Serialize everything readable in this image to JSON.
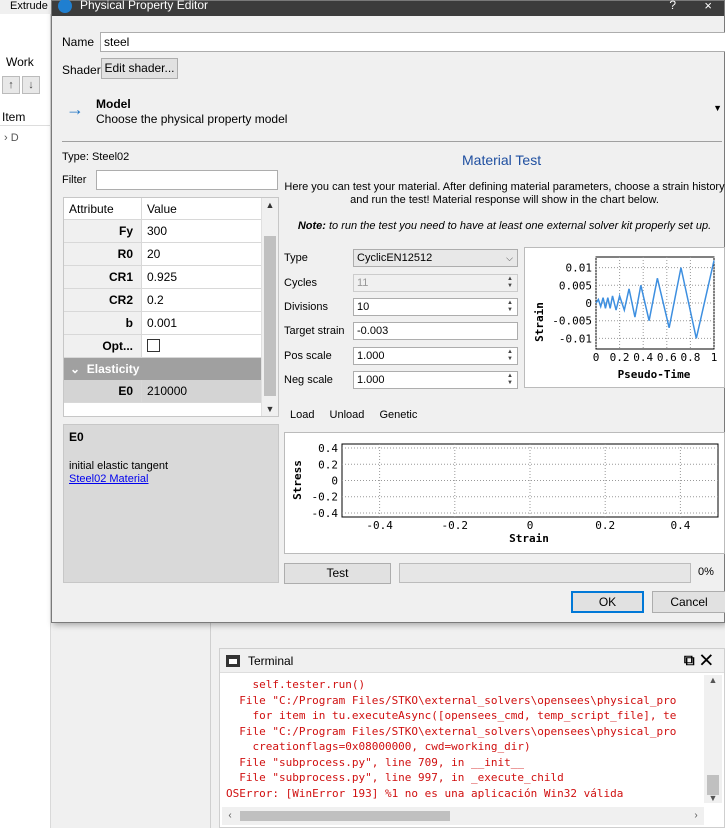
{
  "background": {
    "tab_label": "Extrude",
    "panel_label": "Work",
    "tree_header": "Item",
    "tree_items": [
      "D",
      "",
      "",
      "",
      "",
      "",
      "",
      "",
      ""
    ]
  },
  "dialog": {
    "title": "Physical Property Editor",
    "help_label": "?",
    "close_label": "×",
    "name_label": "Name",
    "name_value": "steel",
    "shader_label": "Shader",
    "shader_button": "Edit shader...",
    "model_title": "Model",
    "model_desc": "Choose the physical property model",
    "type_label": "Type:",
    "type_value": "Steel02",
    "filter_label": "Filter",
    "filter_value": "",
    "table": {
      "headers": [
        "Attribute",
        "Value"
      ],
      "rows": [
        {
          "key": "Fy",
          "value": "300"
        },
        {
          "key": "R0",
          "value": "20"
        },
        {
          "key": "CR1",
          "value": "0.925"
        },
        {
          "key": "CR2",
          "value": "0.2"
        },
        {
          "key": "b",
          "value": "0.001"
        },
        {
          "key": "Opt...",
          "value": ""
        }
      ],
      "group": "Elasticity",
      "group_rows": [
        {
          "key": "E0",
          "value": "210000"
        }
      ]
    },
    "desc": {
      "title": "E0",
      "text": "initial elastic tangent",
      "link": "Steel02 Material"
    },
    "material_test": {
      "title": "Material Test",
      "intro": "Here you can test your material. After defining material parameters, choose a strain history and run the test! Material response will show in the chart below.",
      "note_bold": "Note:",
      "note_text": " to run the test you need to have at least one external solver kit properly set up.",
      "params": {
        "type_label": "Type",
        "type_value": "CyclicEN12512",
        "cycles_label": "Cycles",
        "cycles_value": "11",
        "divisions_label": "Divisions",
        "divisions_value": "10",
        "target_label": "Target strain",
        "target_value": "-0.003",
        "pos_label": "Pos scale",
        "pos_value": "1.000",
        "neg_label": "Neg scale",
        "neg_value": "1.000"
      },
      "tabs": [
        "Load",
        "Unload",
        "Genetic"
      ],
      "test_button": "Test",
      "progress_percent": 0,
      "progress_text": "0%"
    },
    "ok_button": "OK",
    "cancel_button": "Cancel"
  },
  "terminal": {
    "title": "Terminal",
    "lines": [
      "    self.tester.run()",
      "  File \"C:/Program Files/STKO\\external_solvers\\opensees\\physical_pro",
      "    for item in tu.executeAsync([opensees_cmd, temp_script_file], te",
      "  File \"C:/Program Files/STKO\\external_solvers\\opensees\\physical_pro",
      "    creationflags=0x08000000, cwd=working_dir)",
      "  File \"subprocess.py\", line 709, in __init__",
      "  File \"subprocess.py\", line 997, in _execute_child",
      "OSError: [WinError 193] %1 no es una aplicación Win32 válida"
    ]
  },
  "colors": {
    "accent": "#1f75c4",
    "chart_line": "#3d8fe0",
    "terminal_text": "#d01010",
    "titlebar": "#3c3c3c"
  },
  "chart_data": [
    {
      "type": "line",
      "title": "",
      "xlabel": "Pseudo-Time",
      "ylabel": "Strain",
      "xlim": [
        0,
        1
      ],
      "ylim": [
        -0.013,
        0.013
      ],
      "xticks": [
        "0",
        "0.2",
        "0.4",
        "0.6",
        "0.8",
        "1"
      ],
      "yticks": [
        "0.01",
        "0.005",
        "0",
        "-0.005",
        "-0.01"
      ],
      "grid": true,
      "series": [
        {
          "x": [
            0,
            0.02,
            0.04,
            0.06,
            0.08,
            0.1,
            0.12,
            0.14,
            0.17,
            0.2,
            0.24,
            0.28,
            0.33,
            0.38,
            0.45,
            0.52,
            0.62,
            0.72,
            0.85,
            1.0
          ],
          "values": [
            0,
            0.001,
            -0.001,
            0.0015,
            -0.0015,
            0.0015,
            -0.0015,
            0.002,
            -0.002,
            0.002,
            -0.002,
            0.004,
            -0.004,
            0.005,
            -0.005,
            0.007,
            -0.007,
            0.01,
            -0.01,
            0.012
          ]
        }
      ]
    },
    {
      "type": "line",
      "title": "",
      "xlabel": "Strain",
      "ylabel": "Stress",
      "xlim": [
        -0.5,
        0.5
      ],
      "ylim": [
        -0.45,
        0.45
      ],
      "xticks": [
        "-0.4",
        "-0.2",
        "0",
        "0.2",
        "0.4"
      ],
      "yticks": [
        "0.4",
        "0.2",
        "0",
        "-0.2",
        "-0.4"
      ],
      "grid": true,
      "series": []
    }
  ]
}
